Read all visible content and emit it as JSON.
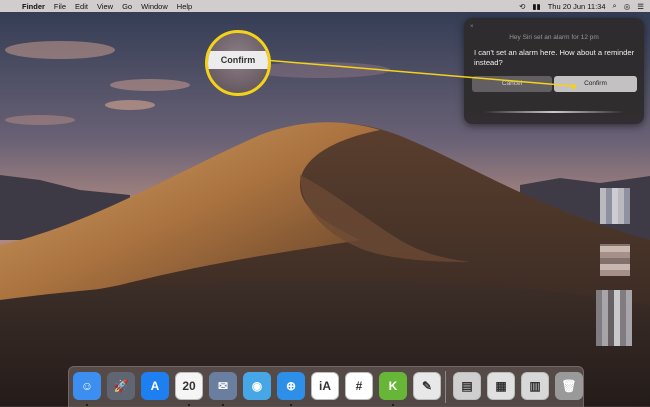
{
  "menubar": {
    "apple": "",
    "items": [
      "Finder",
      "File",
      "Edit",
      "View",
      "Go",
      "Window",
      "Help"
    ],
    "clock": "Thu 20 Jun  11:34"
  },
  "siri": {
    "close": "×",
    "prompt": "Hey Siri set an alarm for 12 pm",
    "response": "I can't set an alarm here. How about a reminder instead?",
    "cancel_label": "Cancel",
    "confirm_label": "Confirm"
  },
  "callout": {
    "label": "Confirm",
    "accent": "#f4d21a"
  },
  "dock": {
    "items": [
      {
        "name": "finder-icon",
        "glyph": "☺",
        "bg": "#3c8ff0"
      },
      {
        "name": "launchpad-icon",
        "glyph": "🚀",
        "bg": "#5f6672"
      },
      {
        "name": "app-store-icon",
        "glyph": "A",
        "bg": "#1e7ff0"
      },
      {
        "name": "calendar-icon",
        "glyph": "20",
        "bg": "#f5f5f5"
      },
      {
        "name": "mail-icon",
        "glyph": "✉",
        "bg": "#6a7fa0"
      },
      {
        "name": "tweetbot-icon",
        "glyph": "◉",
        "bg": "#47a7e6"
      },
      {
        "name": "safari-icon",
        "glyph": "⊕",
        "bg": "#2e8fe8"
      },
      {
        "name": "ia-writer-icon",
        "glyph": "iA",
        "bg": "#ffffff"
      },
      {
        "name": "slack-icon",
        "glyph": "#",
        "bg": "#ffffff"
      },
      {
        "name": "keka-icon",
        "glyph": "K",
        "bg": "#67b637"
      },
      {
        "name": "notes-icon",
        "glyph": "✎",
        "bg": "#e8e8e8"
      },
      {
        "name": "preview-icon",
        "glyph": "▤",
        "bg": "#cfcfcf"
      },
      {
        "name": "document-stack-icon",
        "glyph": "▦",
        "bg": "#e0e0e0"
      },
      {
        "name": "document-pile-icon",
        "glyph": "▥",
        "bg": "#d8d8d8"
      },
      {
        "name": "trash-icon",
        "glyph": "🗑",
        "bg": "#9a9a9a"
      }
    ]
  }
}
